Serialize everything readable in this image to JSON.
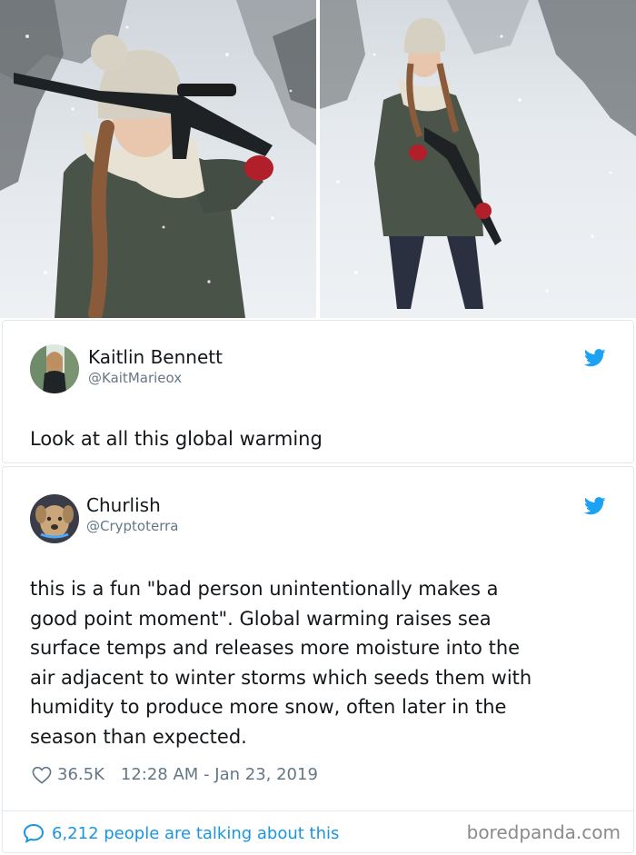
{
  "photos": {
    "left_alt_icon": "photo-winter-rifle-closeup",
    "right_alt_icon": "photo-winter-rifle-fullbody"
  },
  "tweet1": {
    "name": "Kaitlin Bennett",
    "handle": "@KaitMarieox",
    "text": "Look at all this global warming",
    "bird_icon": "twitter-bird-icon"
  },
  "tweet2": {
    "name": "Churlish",
    "handle": "@Cryptoterra",
    "text_lines": [
      "this is a fun \"bad person unintentionally makes a",
      "good point moment\". Global warming raises sea",
      "surface temps and releases more moisture into the",
      "air adjacent to winter storms which seeds them with",
      "humidity to produce more snow, often later in the",
      "season than expected."
    ],
    "likes": "36.5K",
    "timestamp": "12:28 AM - Jan 23, 2019",
    "talking": "6,212 people are talking about this",
    "bird_icon": "twitter-bird-icon"
  },
  "watermark": "boredpanda.com",
  "colors": {
    "twitter_blue": "#1da1f2",
    "link_blue": "#1b95e0",
    "secondary_text": "#657786",
    "border": "#e1e8ed"
  }
}
